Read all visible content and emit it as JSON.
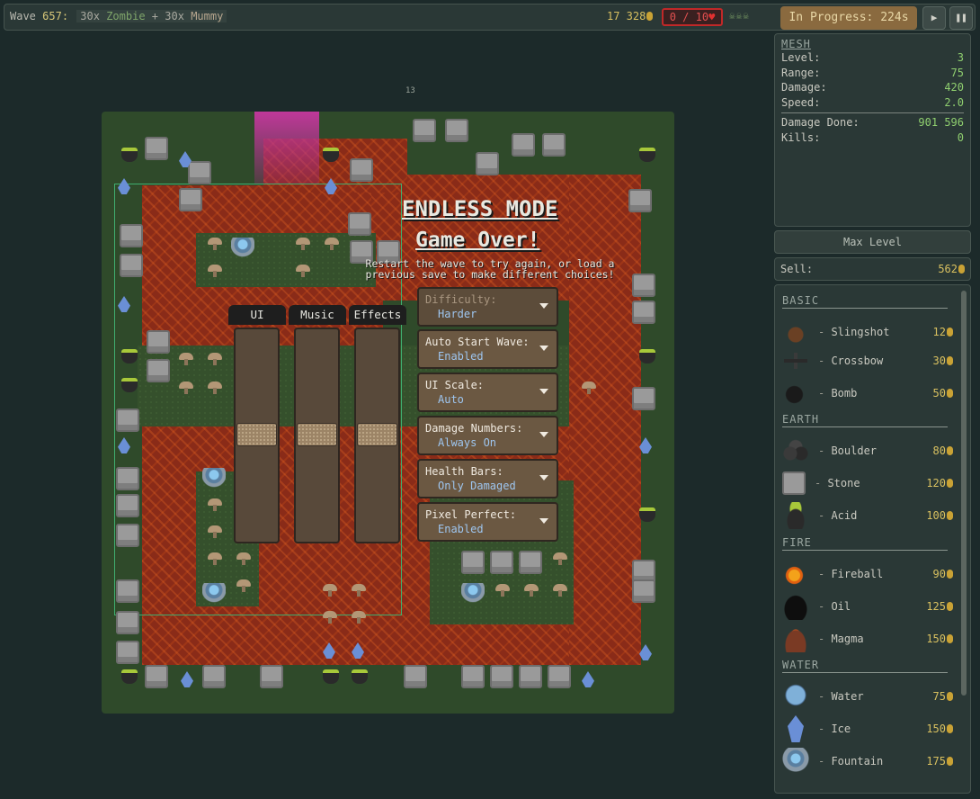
{
  "topbar": {
    "wave_label": "Wave",
    "wave_number": "657:",
    "group1_count": "30x",
    "group1_enemy": "Zombie",
    "plus": "+",
    "group2_count": "30x",
    "group2_enemy": "Mummy",
    "gold": "17 328",
    "lives": "0 / 10",
    "status_button": "In Progress: 224s",
    "play_icon": "play-icon",
    "pause_icon": "pause-icon"
  },
  "game": {
    "wave_marker": "13",
    "endless_title": "ENDLESS MODE",
    "gameover_title": "Game Over!",
    "gameover_message": "Restart the wave to try again, or load a previous save to make different choices!",
    "volume_tabs": [
      "UI",
      "Music",
      "Effects"
    ],
    "volume_levels": [
      0.5,
      0.5,
      0.5
    ],
    "options": [
      {
        "label": "Difficulty:",
        "value": "Harder",
        "disabled": true
      },
      {
        "label": "Auto Start Wave:",
        "value": "Enabled"
      },
      {
        "label": "UI Scale:",
        "value": "Auto"
      },
      {
        "label": "Damage Numbers:",
        "value": "Always On"
      },
      {
        "label": "Health Bars:",
        "value": "Only Damaged"
      },
      {
        "label": "Pixel Perfect:",
        "value": "Enabled"
      }
    ]
  },
  "tower_info": {
    "name": "MESH",
    "stats": [
      {
        "label": "Level:",
        "value": "3"
      },
      {
        "label": "Range:",
        "value": "75"
      },
      {
        "label": "Damage:",
        "value": "420"
      },
      {
        "label": "Speed:",
        "value": "2.0"
      }
    ],
    "totals": [
      {
        "label": "Damage Done:",
        "value": "901 596"
      },
      {
        "label": "Kills:",
        "value": "0"
      }
    ],
    "max_level_button": "Max Level",
    "sell_label": "Sell:",
    "sell_value": "562"
  },
  "shop": {
    "categories": [
      {
        "name": "BASIC",
        "items": [
          {
            "name": "Slingshot",
            "price": "12",
            "icon": "slingshot-icon"
          },
          {
            "name": "Crossbow",
            "price": "30",
            "icon": "crossbow-icon"
          },
          {
            "name": "Bomb",
            "price": "50",
            "icon": "bomb-icon"
          }
        ]
      },
      {
        "name": "EARTH",
        "items": [
          {
            "name": "Boulder",
            "price": "80",
            "icon": "boulder-icon"
          },
          {
            "name": "Stone",
            "price": "120",
            "icon": "stone-icon"
          },
          {
            "name": "Acid",
            "price": "100",
            "icon": "acid-icon"
          }
        ]
      },
      {
        "name": "FIRE",
        "items": [
          {
            "name": "Fireball",
            "price": "90",
            "icon": "fireball-icon"
          },
          {
            "name": "Oil",
            "price": "125",
            "icon": "oil-icon"
          },
          {
            "name": "Magma",
            "price": "150",
            "icon": "magma-icon"
          }
        ]
      },
      {
        "name": "WATER",
        "items": [
          {
            "name": "Water",
            "price": "75",
            "icon": "water-icon"
          },
          {
            "name": "Ice",
            "price": "150",
            "icon": "ice-icon"
          },
          {
            "name": "Fountain",
            "price": "175",
            "icon": "fountain-icon"
          }
        ]
      }
    ]
  }
}
